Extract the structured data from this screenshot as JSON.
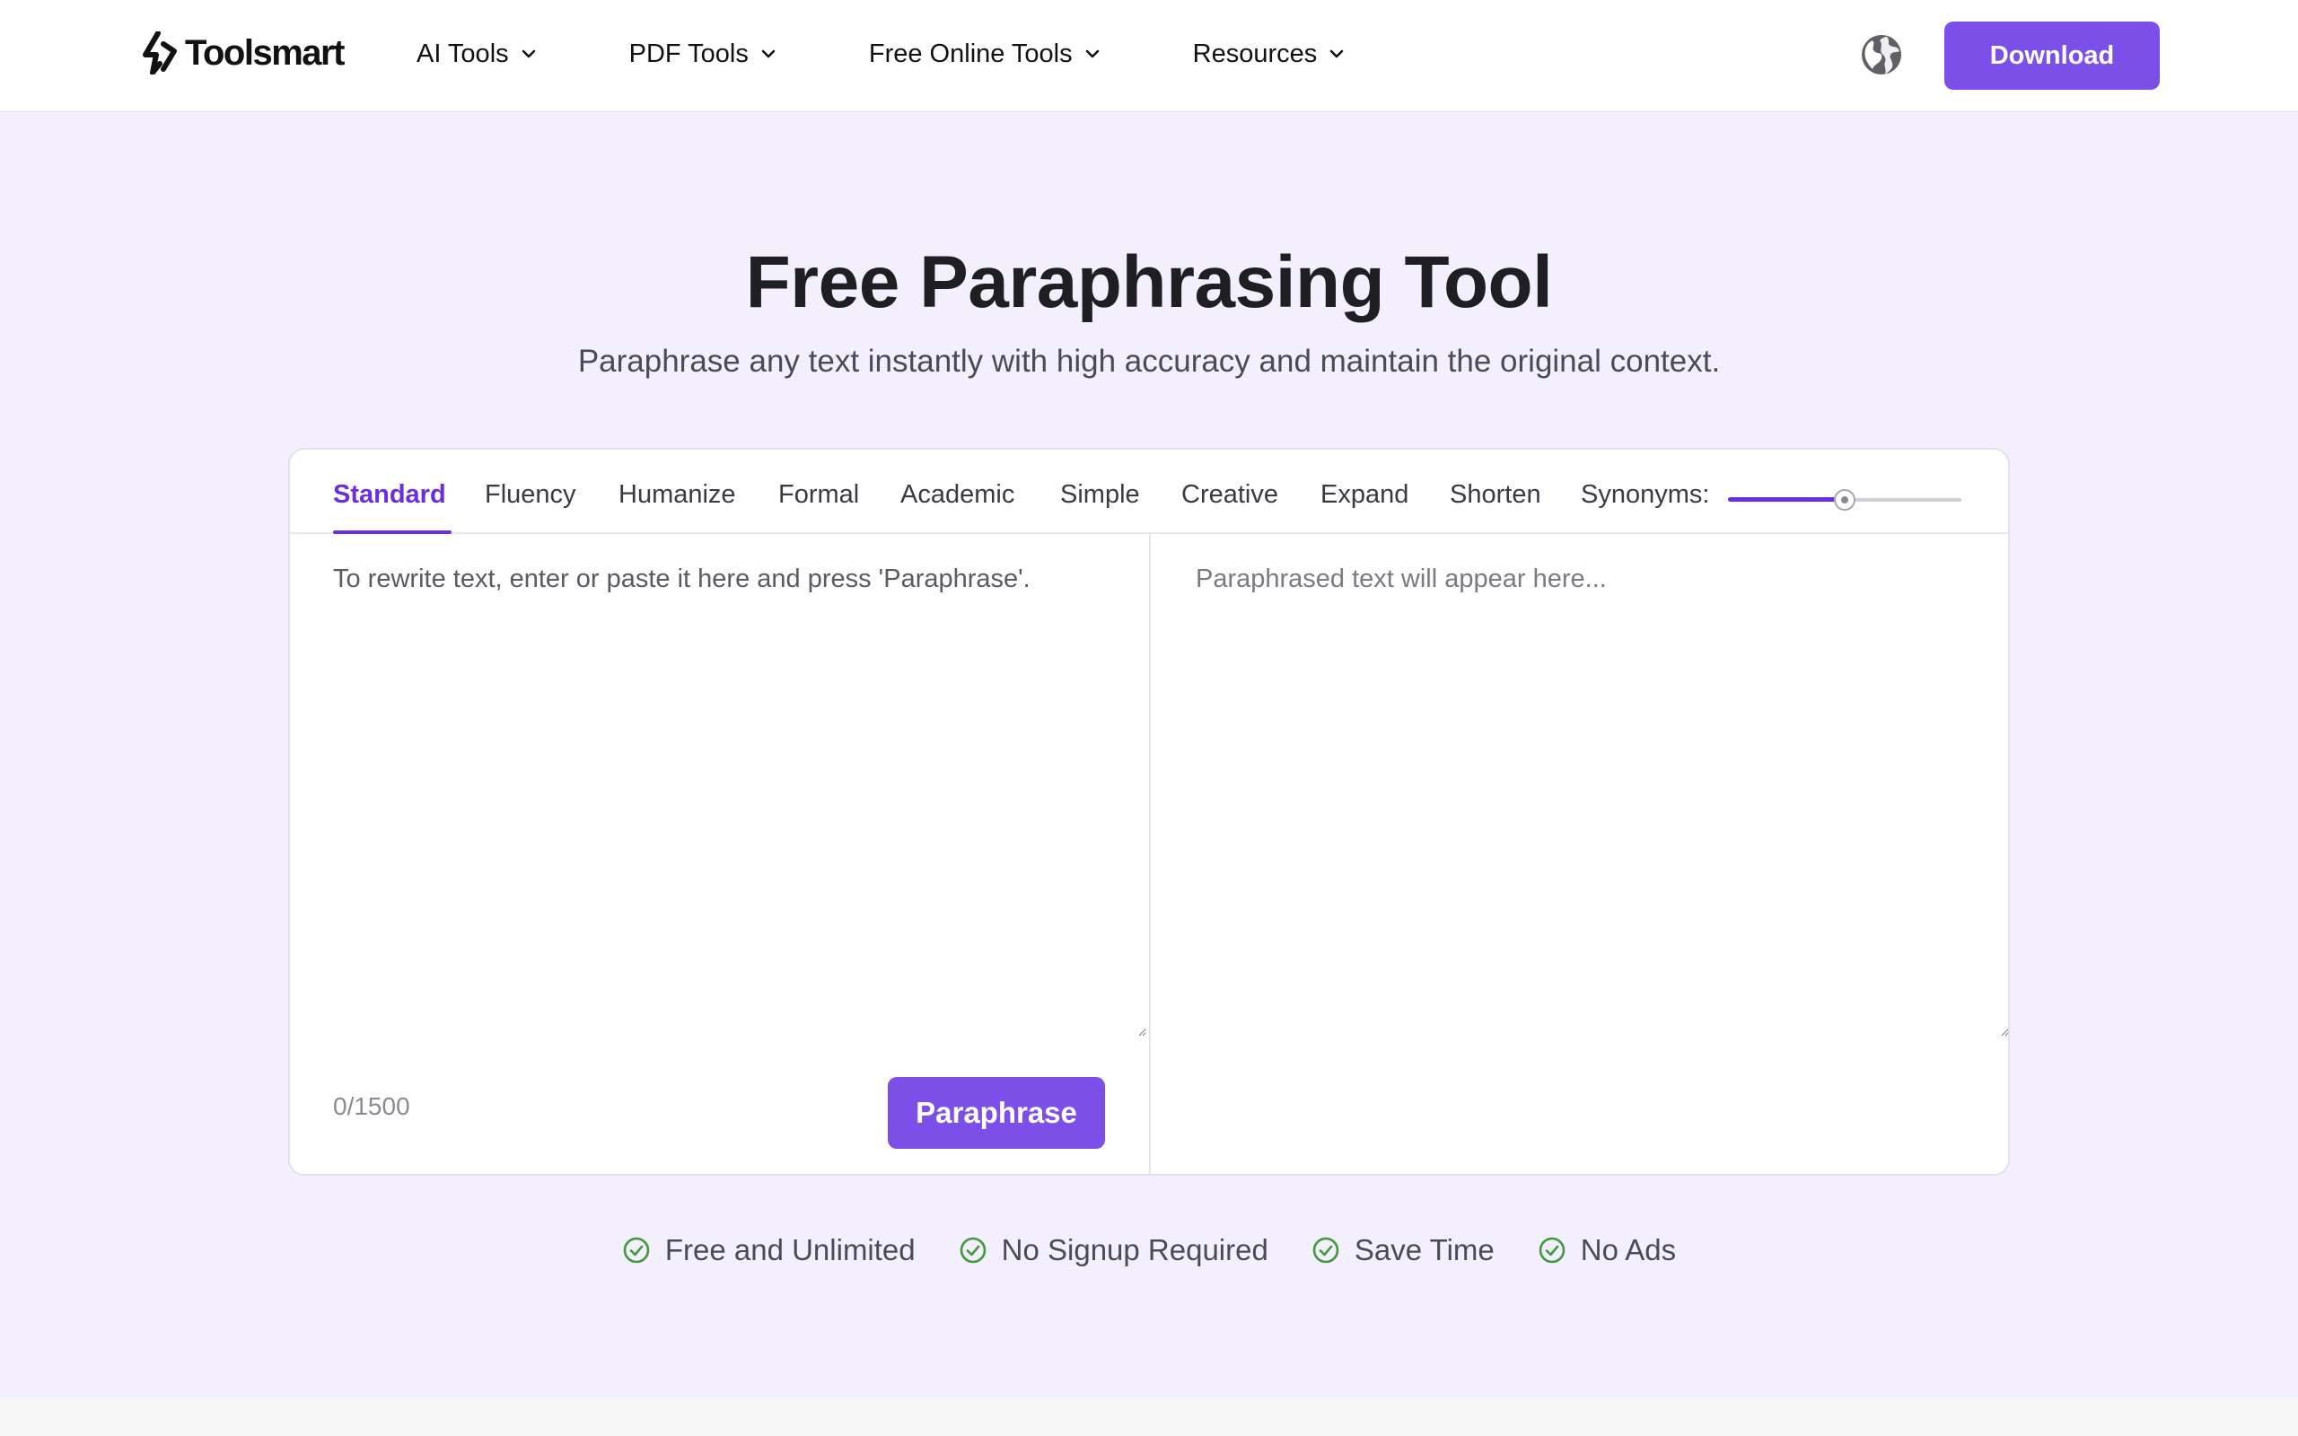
{
  "header": {
    "logo_text": "Toolsmart",
    "nav": [
      {
        "label": "AI Tools"
      },
      {
        "label": "PDF Tools"
      },
      {
        "label": "Free Online Tools"
      },
      {
        "label": "Resources"
      }
    ],
    "download_label": "Download"
  },
  "hero": {
    "title": "Free Paraphrasing Tool",
    "subtitle": "Paraphrase any text instantly with high accuracy and maintain the original context."
  },
  "tool": {
    "tabs": [
      {
        "label": "Standard",
        "active": true
      },
      {
        "label": "Fluency"
      },
      {
        "label": "Humanize"
      },
      {
        "label": "Formal"
      },
      {
        "label": "Academic"
      },
      {
        "label": "Simple"
      },
      {
        "label": "Creative"
      },
      {
        "label": "Expand"
      },
      {
        "label": "Shorten"
      }
    ],
    "synonyms_label": "Synonyms:",
    "synonyms_level": 0.5,
    "input_placeholder": "To rewrite text, enter or paste it here and press 'Paraphrase'.",
    "output_placeholder": "Paraphrased text will appear here...",
    "counter": "0/1500",
    "paraphrase_label": "Paraphrase"
  },
  "features": [
    {
      "label": "Free and Unlimited"
    },
    {
      "label": "No Signup Required"
    },
    {
      "label": "Save Time"
    },
    {
      "label": "No Ads"
    }
  ],
  "colors": {
    "accent": "#7c4fe9",
    "tab_active": "#6a2ee0",
    "check": "#3f9a3a",
    "background": "#f3effc"
  }
}
